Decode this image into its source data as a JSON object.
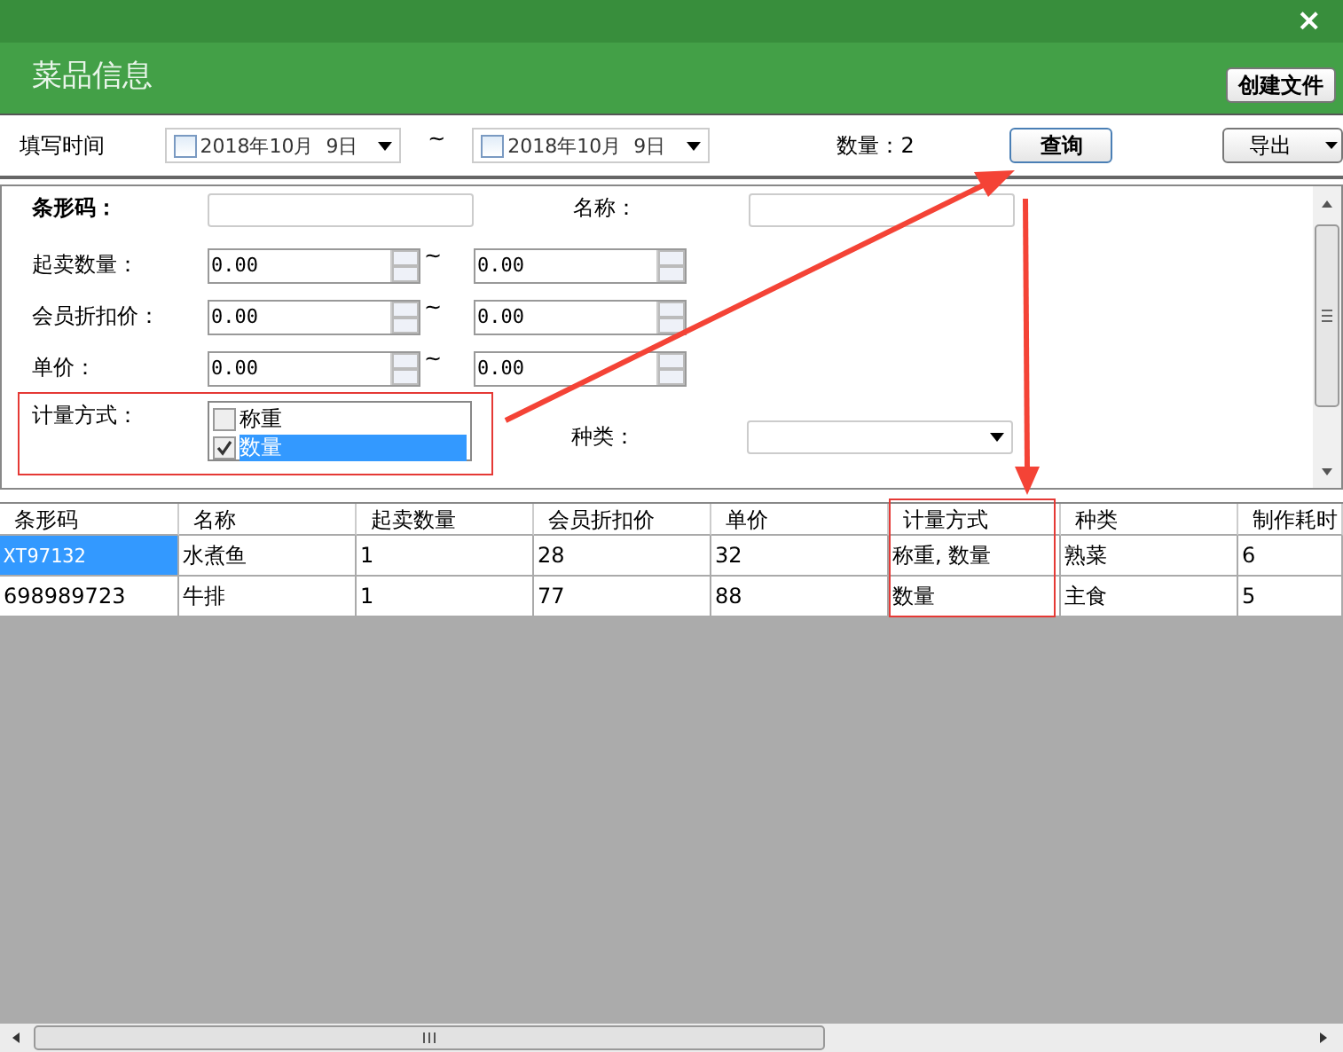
{
  "window": {
    "title": "菜品信息",
    "close": "×"
  },
  "header": {
    "create_button": "创建文件"
  },
  "toolbar": {
    "date_label": "填写时间",
    "date_from": {
      "value": "2018年10月  9日",
      "checked": false
    },
    "separator": "~",
    "date_to": {
      "value": "2018年10月  9日",
      "checked": false
    },
    "count": "数量：2",
    "query_button": "查询",
    "export_button": "导出"
  },
  "filters": {
    "barcode_label": "条形码：",
    "name_label": "名称：",
    "ranges": [
      {
        "label": "起卖数量：",
        "from": "0.00",
        "separator": "~",
        "to": "0.00"
      },
      {
        "label": "会员折扣价：",
        "from": "0.00",
        "separator": "~",
        "to": "0.00"
      },
      {
        "label": "单价：",
        "from": "0.00",
        "separator": "~",
        "to": "0.00"
      }
    ],
    "measure_label": "计量方式：",
    "measure_options": [
      {
        "label": "称重",
        "checked": false,
        "selected": false
      },
      {
        "label": "数量",
        "checked": true,
        "selected": true
      }
    ],
    "category_label": "种类："
  },
  "table": {
    "columns": [
      "条形码",
      "名称",
      "起卖数量",
      "会员折扣价",
      "单价",
      "计量方式",
      "种类",
      "制作耗时"
    ],
    "rows": [
      {
        "selected": true,
        "cells": [
          "XT97132",
          "水煮鱼",
          "1",
          "28",
          "32",
          "称重, 数量",
          "熟菜",
          "6"
        ]
      },
      {
        "selected": false,
        "cells": [
          "698989723",
          "牛排",
          "1",
          "77",
          "88",
          "数量",
          "主食",
          "5"
        ]
      }
    ]
  }
}
